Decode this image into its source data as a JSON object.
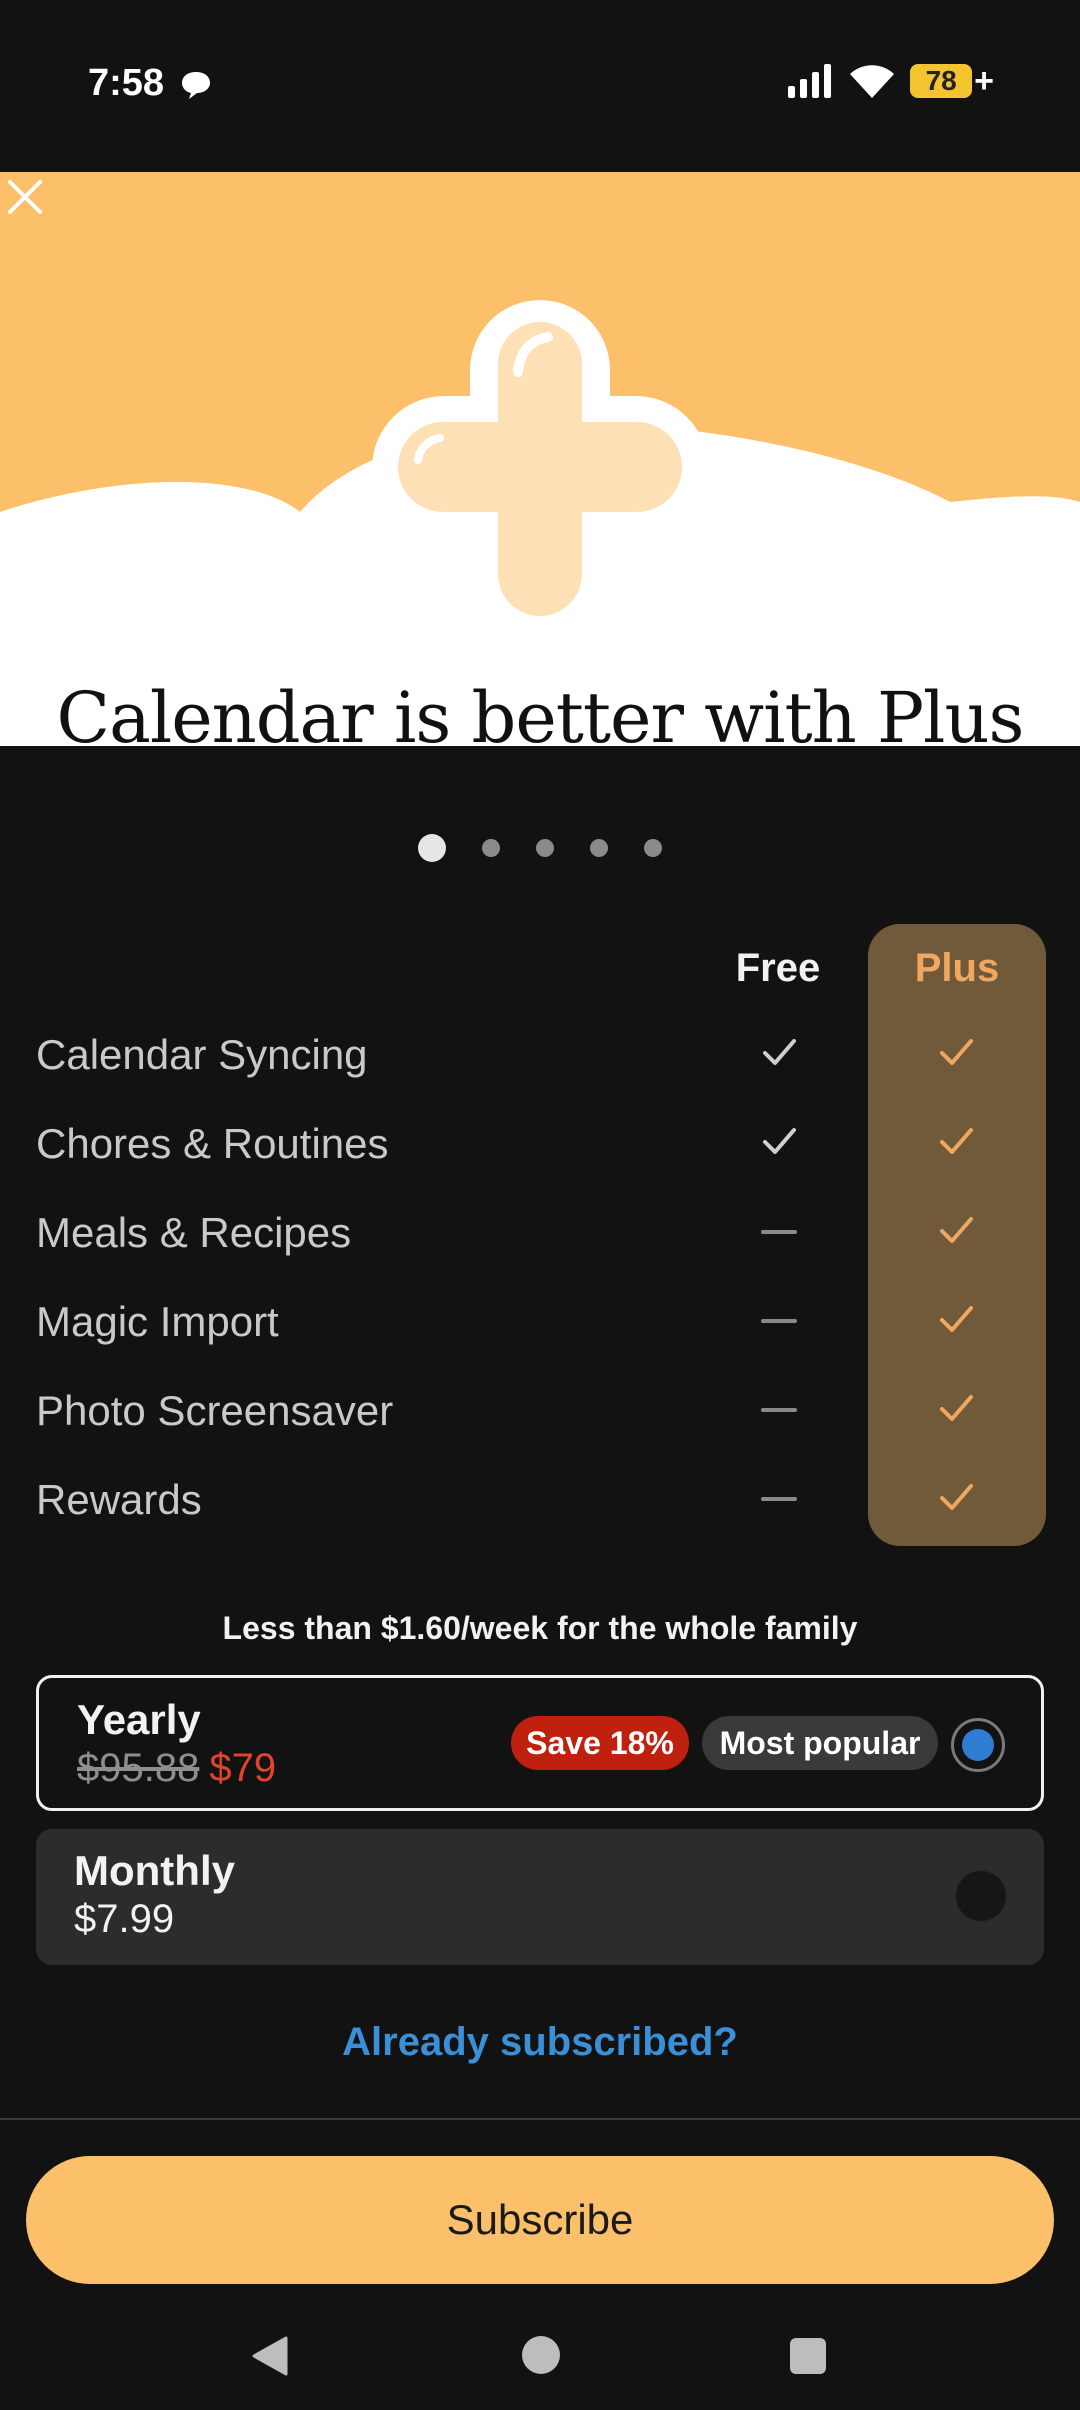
{
  "status_bar": {
    "time": "7:58",
    "battery_level": "78",
    "icons": [
      "chat-icon",
      "signal-icon",
      "wifi-icon",
      "battery-icon",
      "charging-plus-icon"
    ]
  },
  "hero": {
    "headline": "Calendar is better with Plus",
    "close_icon": "close-icon",
    "illustration": "plus-cross-illustration",
    "colors": {
      "sky": "#FCC06A",
      "cloud": "#FFFFFF",
      "cross": "#FDE0B6"
    }
  },
  "pager": {
    "count": 5,
    "active_index": 0
  },
  "comparison": {
    "columns": {
      "free": "Free",
      "plus": "Plus"
    },
    "rows": [
      {
        "feature": "Calendar Syncing",
        "free": "check",
        "plus": "check"
      },
      {
        "feature": "Chores & Routines",
        "free": "check",
        "plus": "check"
      },
      {
        "feature": "Meals & Recipes",
        "free": "dash",
        "plus": "check"
      },
      {
        "feature": "Magic Import",
        "free": "dash",
        "plus": "check"
      },
      {
        "feature": "Photo Screensaver",
        "free": "dash",
        "plus": "check"
      },
      {
        "feature": "Rewards",
        "free": "dash",
        "plus": "check"
      }
    ]
  },
  "pricing": {
    "tagline": "Less than $1.60/week for the whole family",
    "plans": [
      {
        "name": "Yearly",
        "old_price": "$95.88",
        "price": "$79",
        "badges": [
          "Save 18%",
          "Most popular"
        ],
        "selected": true
      },
      {
        "name": "Monthly",
        "price": "$7.99",
        "selected": false
      }
    ]
  },
  "links": {
    "already_subscribed": "Already subscribed?"
  },
  "cta": {
    "subscribe_label": "Subscribe"
  },
  "nav_bar": {
    "icons": [
      "back-icon",
      "home-icon",
      "recents-icon"
    ]
  },
  "colors": {
    "background": "#121212",
    "accent": "#FCC06A",
    "plus_column": "#705A39",
    "plus_text": "#F0A860",
    "save_badge": "#C0200E",
    "link": "#3A8FD6",
    "radio_selected": "#2F7DD3"
  }
}
